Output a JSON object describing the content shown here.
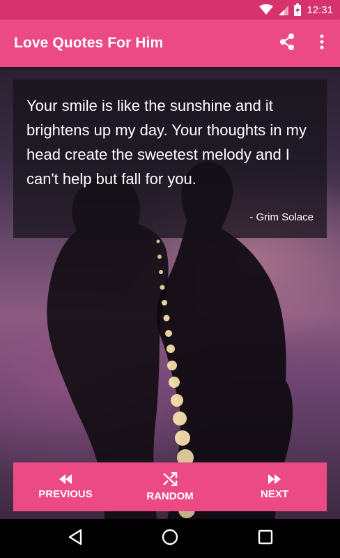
{
  "status_bar": {
    "time": "12:31"
  },
  "app_bar": {
    "title": "Love Quotes For Him"
  },
  "quote": {
    "text": "Your smile is like the sunshine and it brightens up my day. Your thoughts in my head create the sweetest melody and I can't help but fall for you.",
    "author": "- Grim Solace"
  },
  "controls": {
    "previous_label": "PREVIOUS",
    "random_label": "RANDOM",
    "next_label": "NEXT"
  },
  "colors": {
    "status_bar": "#d6336c",
    "app_bar": "#ec4a84",
    "controls": "#ec4a84"
  }
}
